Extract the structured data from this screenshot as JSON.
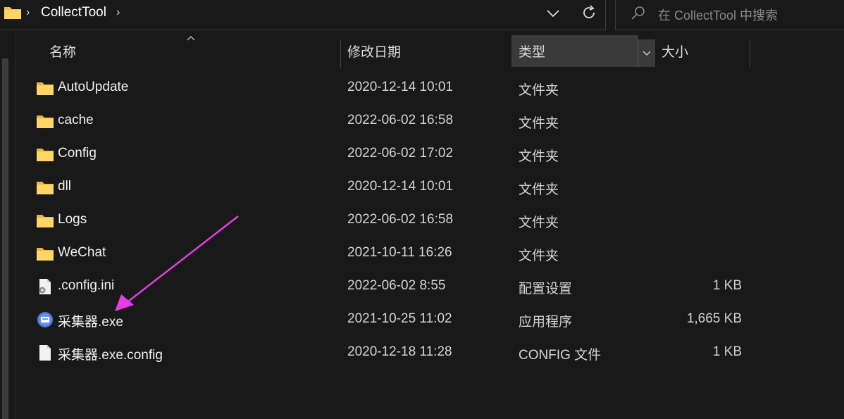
{
  "address_bar": {
    "breadcrumb": "CollectTool",
    "separator": "›"
  },
  "search": {
    "placeholder": "在 CollectTool 中搜索"
  },
  "columns": {
    "name": "名称",
    "date": "修改日期",
    "type": "类型",
    "size": "大小"
  },
  "files": [
    {
      "name": "AutoUpdate",
      "date": "2020-12-14 10:01",
      "type": "文件夹",
      "size": "",
      "icon": "folder-icon"
    },
    {
      "name": "cache",
      "date": "2022-06-02 16:58",
      "type": "文件夹",
      "size": "",
      "icon": "folder-icon"
    },
    {
      "name": "Config",
      "date": "2022-06-02 17:02",
      "type": "文件夹",
      "size": "",
      "icon": "folder-icon"
    },
    {
      "name": "dll",
      "date": "2020-12-14 10:01",
      "type": "文件夹",
      "size": "",
      "icon": "folder-icon"
    },
    {
      "name": "Logs",
      "date": "2022-06-02 16:58",
      "type": "文件夹",
      "size": "",
      "icon": "folder-icon"
    },
    {
      "name": "WeChat",
      "date": "2021-10-11 16:26",
      "type": "文件夹",
      "size": "",
      "icon": "folder-icon"
    },
    {
      "name": ".config.ini",
      "date": "2022-06-02 8:55",
      "type": "配置设置",
      "size": "1 KB",
      "icon": "config-settings-icon"
    },
    {
      "name": "采集器.exe",
      "date": "2021-10-25 11:02",
      "type": "应用程序",
      "size": "1,665 KB",
      "icon": "application-icon"
    },
    {
      "name": "采集器.exe.config",
      "date": "2020-12-18 11:28",
      "type": "CONFIG 文件",
      "size": "1 KB",
      "icon": "file-icon"
    }
  ],
  "colors": {
    "background": "#191919",
    "folder_yellow": "#f4c04a",
    "annotation_arrow": "#e63ce6"
  }
}
